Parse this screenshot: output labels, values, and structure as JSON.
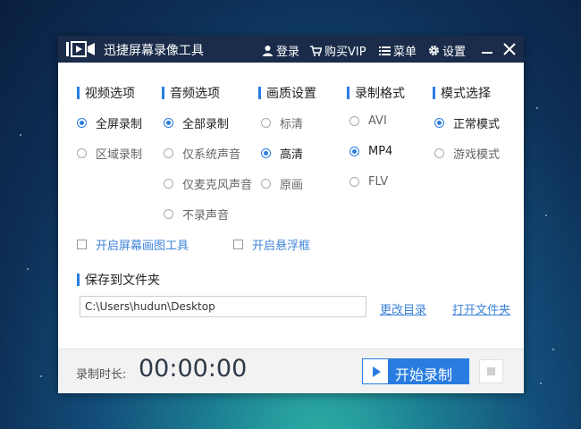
{
  "app": {
    "title": "迅捷屏幕录像工具"
  },
  "titlebar": {
    "login": "登录",
    "buy_vip": "购买VIP",
    "menu": "菜单",
    "settings": "设置"
  },
  "sections": {
    "video": {
      "label": "视频选项",
      "options": [
        {
          "label": "全屏录制",
          "selected": true
        },
        {
          "label": "区域录制",
          "selected": false
        }
      ]
    },
    "audio": {
      "label": "音频选项",
      "options": [
        {
          "label": "全部录制",
          "selected": true
        },
        {
          "label": "仅系统声音",
          "selected": false
        },
        {
          "label": "仅麦克风声音",
          "selected": false
        },
        {
          "label": "不录声音",
          "selected": false
        }
      ]
    },
    "quality": {
      "label": "画质设置",
      "options": [
        {
          "label": "标清",
          "selected": false
        },
        {
          "label": "高清",
          "selected": true
        },
        {
          "label": "原画",
          "selected": false
        }
      ]
    },
    "format": {
      "label": "录制格式",
      "options": [
        {
          "label": "AVI",
          "selected": false
        },
        {
          "label": "MP4",
          "selected": true
        },
        {
          "label": "FLV",
          "selected": false
        }
      ]
    },
    "mode": {
      "label": "模式选择",
      "options": [
        {
          "label": "正常模式",
          "selected": true
        },
        {
          "label": "游戏模式",
          "selected": false
        }
      ]
    }
  },
  "extras": {
    "screen_draw_tool": {
      "label": "开启屏幕画图工具",
      "checked": false
    },
    "floating_frame": {
      "label": "开启悬浮框",
      "checked": false
    }
  },
  "save": {
    "label": "保存到文件夹",
    "path": "C:\\Users\\hudun\\Desktop",
    "change_dir": "更改目录",
    "open_folder": "打开文件夹"
  },
  "footer": {
    "duration_label": "录制时长:",
    "duration": "00:00:00",
    "start_label": "开始录制"
  },
  "colors": {
    "accent": "#2a7de0",
    "titlebar": "#1a2c4a",
    "link": "#3d83d8"
  }
}
